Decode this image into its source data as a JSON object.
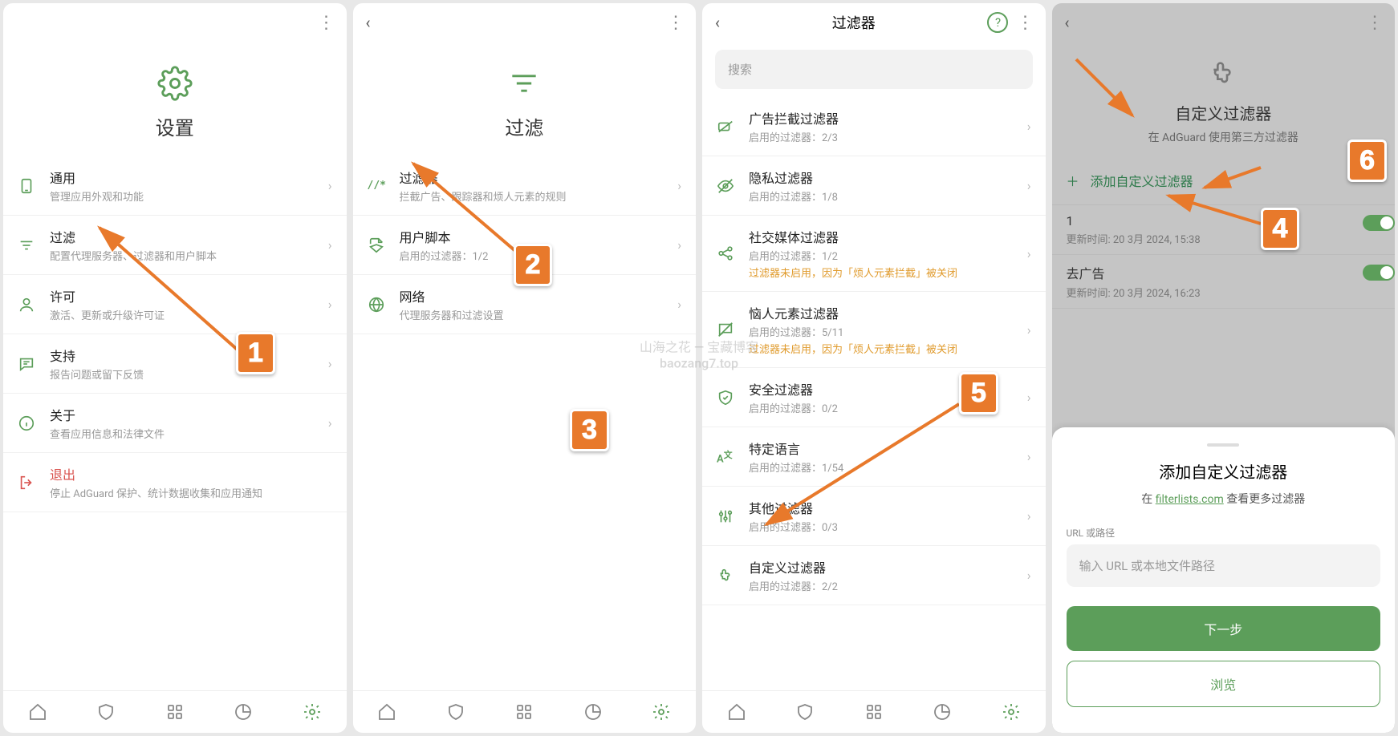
{
  "panel1": {
    "title": "设置",
    "items": [
      {
        "title": "通用",
        "sub": "管理应用外观和功能"
      },
      {
        "title": "过滤",
        "sub": "配置代理服务器、过滤器和用户脚本"
      },
      {
        "title": "许可",
        "sub": "激活、更新或升级许可证"
      },
      {
        "title": "支持",
        "sub": "报告问题或留下反馈"
      },
      {
        "title": "关于",
        "sub": "查看应用信息和法律文件"
      },
      {
        "title": "退出",
        "sub": "停止 AdGuard 保护、统计数据收集和应用通知"
      }
    ]
  },
  "panel2": {
    "title": "过滤",
    "items": [
      {
        "title": "过滤器",
        "sub": "拦截广告、跟踪器和烦人元素的规则"
      },
      {
        "title": "用户脚本",
        "sub": "启用的过滤器：1/2"
      },
      {
        "title": "网络",
        "sub": "代理服务器和过滤设置"
      }
    ]
  },
  "panel3": {
    "title": "过滤器",
    "search": "搜索",
    "items": [
      {
        "title": "广告拦截过滤器",
        "sub": "启用的过滤器：2/3"
      },
      {
        "title": "隐私过滤器",
        "sub": "启用的过滤器：1/8"
      },
      {
        "title": "社交媒体过滤器",
        "sub": "启用的过滤器：1/2",
        "warn": "过滤器未启用，因为「烦人元素拦截」被关闭"
      },
      {
        "title": "恼人元素过滤器",
        "sub": "启用的过滤器：5/11",
        "warn": "过滤器未启用，因为「烦人元素拦截」被关闭"
      },
      {
        "title": "安全过滤器",
        "sub": "启用的过滤器：0/2"
      },
      {
        "title": "特定语言",
        "sub": "启用的过滤器：1/54"
      },
      {
        "title": "其他过滤器",
        "sub": "启用的过滤器：0/3"
      },
      {
        "title": "自定义过滤器",
        "sub": "启用的过滤器：2/2"
      }
    ]
  },
  "panel4": {
    "hero_title": "自定义过滤器",
    "hero_sub": "在 AdGuard 使用第三方过滤器",
    "add": "添加自定义过滤器",
    "items": [
      {
        "title": "1",
        "sub": "更新时间: 20 3月 2024, 15:38"
      },
      {
        "title": "去广告",
        "sub": "更新时间: 20 3月 2024, 16:23"
      }
    ],
    "sheet": {
      "title": "添加自定义过滤器",
      "sub_pre": "在 ",
      "link": "filterlists.com",
      "sub_post": " 查看更多过滤器",
      "field_label": "URL 或路径",
      "placeholder": "输入 URL 或本地文件路径",
      "next": "下一步",
      "browse": "浏览"
    }
  },
  "watermark": {
    "line1": "山海之花 — 宝藏博客",
    "line2": "baozang7.top"
  },
  "badges": {
    "b1": "1",
    "b2": "2",
    "b3": "3",
    "b4": "4",
    "b5": "5",
    "b6": "6"
  }
}
